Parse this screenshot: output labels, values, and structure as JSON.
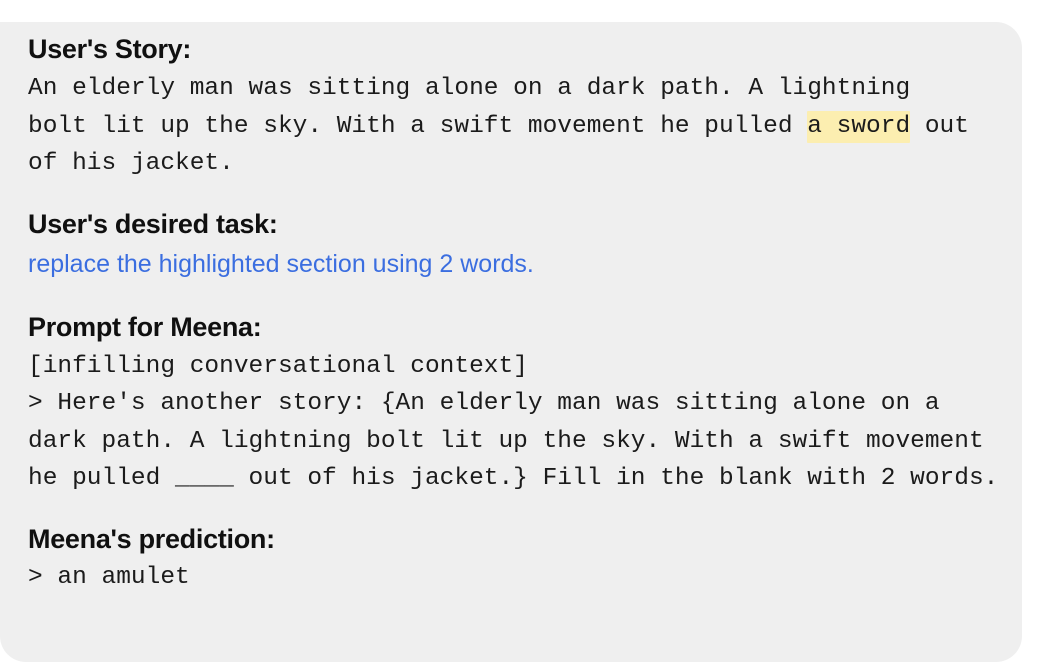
{
  "panel": {
    "background_color": "#efefef",
    "page_background_color": "#ffffff",
    "corner_radius_px": 26
  },
  "colors": {
    "heading_text": "#101010",
    "mono_text": "#1b1b1b",
    "task_text_blue": "#3b6ee0",
    "highlight_yellow": "#fceeb0"
  },
  "sections": {
    "story": {
      "heading": "User's Story:",
      "body_before_highlight": "An elderly man was sitting alone on a dark path. A lightning bolt lit up the sky. With a swift movement he pulled ",
      "highlighted_text": "a sword",
      "body_after_highlight": " out of his jacket.",
      "full_text": "An elderly man was sitting alone on a dark path. A lightning bolt lit up the sky. With a swift movement he pulled a sword out of his jacket."
    },
    "task": {
      "heading": "User's desired task:",
      "text": "replace the highlighted section using 2 words."
    },
    "prompt": {
      "heading": "Prompt for Meena:",
      "context_label": "[infilling conversational context]",
      "body": "> Here's another story: {An elderly man was sitting alone on a dark path. A lightning bolt lit up the sky. With a swift movement he pulled ____ out of his jacket.} Fill in the blank with 2 words.",
      "blank_token": "____",
      "blank_word_count": "2"
    },
    "prediction": {
      "heading": "Meena's prediction:",
      "text": "> an amulet"
    }
  }
}
